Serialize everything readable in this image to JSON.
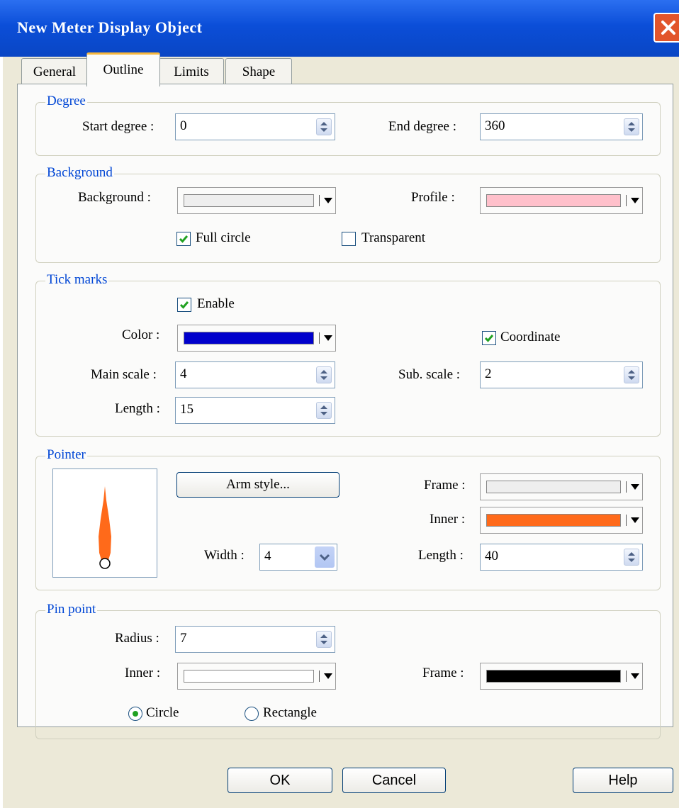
{
  "window": {
    "title": "New  Meter Display Object"
  },
  "tabs": [
    {
      "label": "General"
    },
    {
      "label": "Outline"
    },
    {
      "label": "Limits"
    },
    {
      "label": "Shape"
    }
  ],
  "degree": {
    "legend": "Degree",
    "start_label": "Start degree :",
    "start_value": "0",
    "end_label": "End degree :",
    "end_value": "360"
  },
  "background": {
    "legend": "Background",
    "background_label": "Background :",
    "background_color": "#eeeeee",
    "profile_label": "Profile :",
    "profile_color": "#ffc0cb",
    "full_circle_label": "Full circle",
    "full_circle_checked": true,
    "transparent_label": "Transparent",
    "transparent_checked": false
  },
  "tick_marks": {
    "legend": "Tick marks",
    "enable_label": "Enable",
    "enable_checked": true,
    "color_label": "Color :",
    "color": "#0000cc",
    "coordinate_label": "Coordinate",
    "coordinate_checked": true,
    "main_scale_label": "Main scale :",
    "main_scale_value": "4",
    "sub_scale_label": "Sub. scale :",
    "sub_scale_value": "2",
    "length_label": "Length :",
    "length_value": "15"
  },
  "pointer": {
    "legend": "Pointer",
    "arm_style_label": "Arm style...",
    "frame_label": "Frame :",
    "frame_color": "#eeeeee",
    "inner_label": "Inner :",
    "inner_color": "#ff6a1a",
    "width_label": "Width :",
    "width_value": "4",
    "length_label": "Length :",
    "length_value": "40"
  },
  "pin_point": {
    "legend": "Pin point",
    "radius_label": "Radius :",
    "radius_value": "7",
    "inner_label": "Inner :",
    "inner_color": "#ffffff",
    "frame_label": "Frame :",
    "frame_color": "#000000",
    "circle_label": "Circle",
    "circle_selected": true,
    "rectangle_label": "Rectangle",
    "rectangle_selected": false
  },
  "footer": {
    "ok_label": "OK",
    "cancel_label": "Cancel",
    "help_label": "Help"
  }
}
